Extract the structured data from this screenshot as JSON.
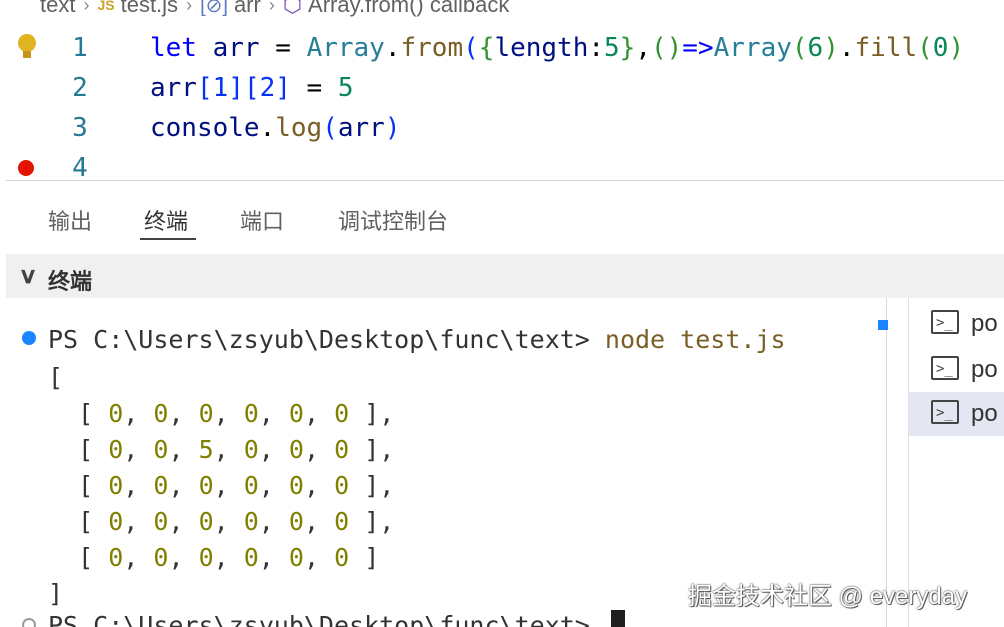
{
  "breadcrumb": {
    "items": [
      "text",
      "test.js",
      "arr",
      "Array.from() callback"
    ],
    "js_badge": "JS"
  },
  "editor": {
    "line_numbers": [
      "1",
      "2",
      "3",
      "4"
    ],
    "line1": {
      "let": "let",
      "arr": "arr",
      "eq": " = ",
      "Array": "Array",
      "dot": ".",
      "from": "from",
      "lp": "(",
      "lb": "{",
      "length": "length",
      "colon": ":",
      "five": "5",
      "rb": "}",
      "comma": ",",
      "arrow_parens": "()",
      "arrow": "=>",
      "Array2": "Array",
      "lp2": "(",
      "six": "6",
      "rp2": ")",
      "dot2": ".",
      "fill": "fill",
      "lp3": "(",
      "zero": "0",
      "rp3": ")"
    },
    "line2": {
      "arr": "arr",
      "i1": "[1]",
      "i2": "[2]",
      "eq": " = ",
      "five": "5"
    },
    "line3": {
      "console": "console",
      "dot": ".",
      "log": "log",
      "lp": "(",
      "arr": "arr",
      "rp": ")"
    }
  },
  "panel": {
    "tabs": [
      "输出",
      "终端",
      "端口",
      "调试控制台"
    ],
    "active_tab": "终端",
    "terminal_header": "终端"
  },
  "terminal": {
    "prompt": "PS C:\\Users\\zsyub\\Desktop\\func\\text> ",
    "command": "node test.js",
    "open_bracket": "[",
    "rows": [
      [
        "0",
        "0",
        "0",
        "0",
        "0",
        "0"
      ],
      [
        "0",
        "0",
        "5",
        "0",
        "0",
        "0"
      ],
      [
        "0",
        "0",
        "0",
        "0",
        "0",
        "0"
      ],
      [
        "0",
        "0",
        "0",
        "0",
        "0",
        "0"
      ],
      [
        "0",
        "0",
        "0",
        "0",
        "0",
        "0"
      ]
    ],
    "close_bracket": "]",
    "prompt2": "PS C:\\Users\\zsyub\\Desktop\\func\\text> "
  },
  "terminal_list": {
    "items": [
      "po",
      "po",
      "po"
    ],
    "selected_index": 2
  },
  "watermark": "掘金技术社区 @ everyday",
  "colors": {
    "keyword": "#0000ff",
    "variable": "#001080",
    "type": "#267f99",
    "function": "#795e26",
    "number": "#098658",
    "terminal_number": "#808000",
    "breakpoint": "#e51400",
    "accent": "#1a85ff"
  },
  "icons": [
    "lightbulb-icon",
    "breakpoint-icon",
    "js-file-icon",
    "variable-symbol-icon",
    "method-symbol-icon",
    "chevron-down-icon",
    "powershell-icon"
  ]
}
